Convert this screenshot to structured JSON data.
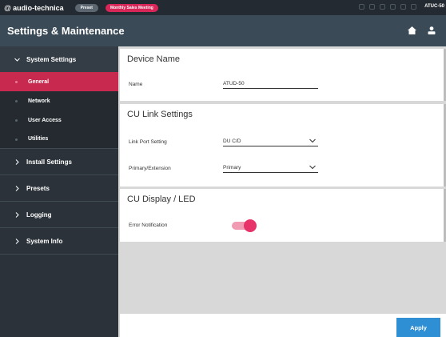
{
  "topbar": {
    "brand": "audio-technica",
    "brand_mark": "@",
    "preset_label": "Preset",
    "meeting_label": "Monthly Sales Meeting",
    "model": "ATUC-50"
  },
  "header": {
    "title": "Settings & Maintenance"
  },
  "sidebar": {
    "sections": [
      {
        "label": "System Settings",
        "expanded": true,
        "items": [
          {
            "label": "General",
            "active": true
          },
          {
            "label": "Network",
            "active": false
          },
          {
            "label": "User Access",
            "active": false
          },
          {
            "label": "Utilities",
            "active": false
          }
        ]
      },
      {
        "label": "Install Settings",
        "expanded": false
      },
      {
        "label": "Presets",
        "expanded": false
      },
      {
        "label": "Logging",
        "expanded": false
      },
      {
        "label": "System Info",
        "expanded": false
      }
    ]
  },
  "main": {
    "device_name": {
      "title": "Device Name",
      "name_label": "Name",
      "name_value": "ATUD-50"
    },
    "cu_link": {
      "title": "CU Link Settings",
      "link_port_label": "Link Port Setting",
      "link_port_value": "DU C/D",
      "primary_label": "Primary/Extension",
      "primary_value": "Primary"
    },
    "cu_display": {
      "title": "CU Display / LED",
      "error_label": "Error Notification",
      "error_enabled": true
    },
    "apply_label": "Apply"
  },
  "colors": {
    "accent": "#c8294f",
    "toggle_on": "#e8336a",
    "apply": "#2f8fd5",
    "header_bg": "#3a4a57",
    "sidebar_bg": "#2b3239"
  },
  "icons": {
    "home": "home-icon",
    "user": "user-icon",
    "chevron_down": "chevron-down-icon",
    "chevron_right": "chevron-right-icon"
  }
}
